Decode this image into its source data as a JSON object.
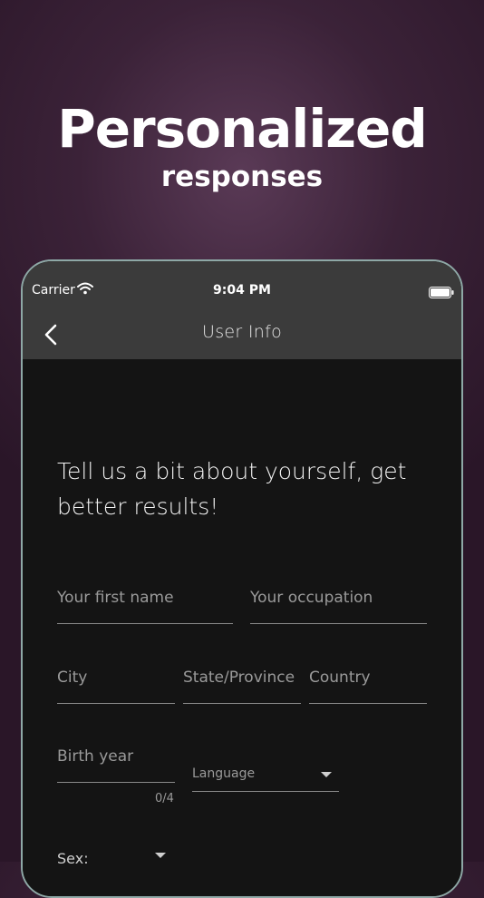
{
  "promo": {
    "title": "Personalized",
    "subtitle": "responses"
  },
  "status_bar": {
    "carrier": "Carrier",
    "time": "9:04 PM"
  },
  "nav": {
    "title": "User Info"
  },
  "intro_text": "Tell us a bit about yourself, get better results!",
  "form": {
    "first_name_placeholder": "Your first name",
    "occupation_placeholder": "Your occupation",
    "city_placeholder": "City",
    "state_placeholder": "State/Province",
    "country_placeholder": "Country",
    "birth_year_placeholder": "Birth year",
    "birth_year_counter": "0/4",
    "language_label": "Language",
    "sex_label": "Sex:"
  },
  "colors": {
    "background": "#3b2238",
    "bar": "#3b3b3b",
    "screen": "#141414",
    "device_frame": "#8ea8a6"
  },
  "icons": [
    "wifi-icon",
    "battery-icon",
    "chevron-left-icon",
    "caret-down-icon"
  ]
}
